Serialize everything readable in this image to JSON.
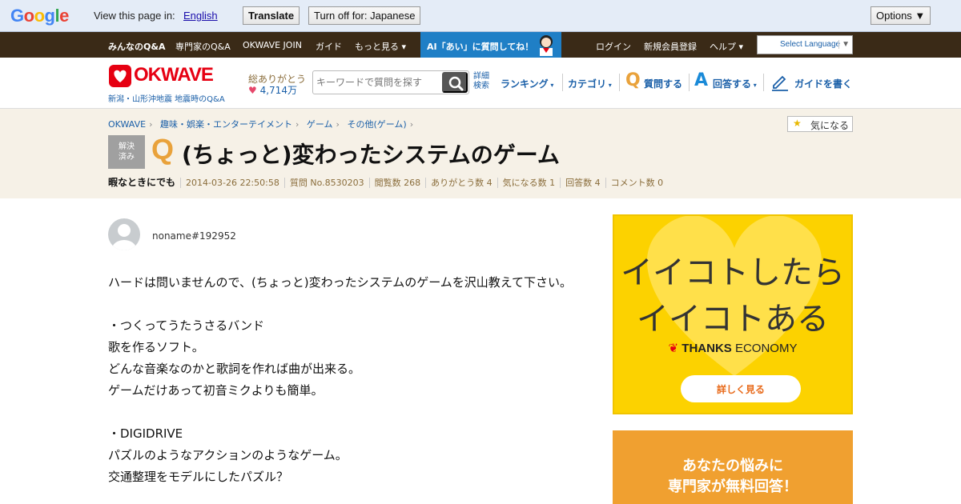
{
  "translate_bar": {
    "view_text": "View this page in:",
    "language": "English",
    "translate_label": "Translate",
    "turn_off_label": "Turn off for: Japanese",
    "options_label": "Options ▼"
  },
  "top_nav": {
    "items": [
      "みんなのQ&A",
      "専門家のQ&A",
      "OKWAVE JOIN",
      "ガイド",
      "もっと見る ▾"
    ],
    "ai_banner": "AI「あい」に質問してね！",
    "right_items": [
      "ログイン",
      "新規会員登録",
      "ヘルプ ▾"
    ],
    "language_select": "Select Language"
  },
  "header": {
    "logo_text": "OKWAVE",
    "logo_sub": "新潟・山形沖地震 地震時のQ&A",
    "thanks_label": "総ありがとう",
    "thanks_count": "4,714万",
    "search_placeholder": "キーワードで質問を探す",
    "advanced_search": "詳細検索",
    "ranking": "ランキング",
    "category": "カテゴリ",
    "ask": "質問する",
    "answer": "回答する",
    "guide": "ガイドを書く",
    "q_letter": "Q",
    "a_letter": "A"
  },
  "breadcrumbs": [
    "OKWAVE",
    "趣味・娯楽・エンターテイメント",
    "ゲーム",
    "その他(ゲーム)"
  ],
  "question": {
    "kininaru_label": "気になる",
    "solved_label_1": "解決",
    "solved_label_2": "済み",
    "q_mark": "Q",
    "title": "(ちょっと)変わったシステムのゲーム",
    "meta": {
      "subtitle": "暇なときにでも",
      "date": "2014-03-26 22:50:58",
      "number": "質問 No.8530203",
      "views": "閲覧数 268",
      "thanks": "ありがとう数 4",
      "kininaru": "気になる数 1",
      "answers": "回答数 4",
      "comments": "コメント数 0"
    },
    "username": "noname#192952",
    "body": [
      "ハードは問いませんので、(ちょっと)変わったシステムのゲームを沢山教えて下さい。",
      "",
      "・つくってうたうさるバンド",
      "歌を作るソフト。",
      "どんな音楽なのかと歌詞を作れば曲が出来る。",
      "ゲームだけあって初音ミクよりも簡単。",
      "",
      "・DIGIDRIVE",
      "パズルのようなアクションのようなゲーム。",
      "交通整理をモデルにしたパズル？"
    ]
  },
  "ads": {
    "ad1_line1": "イイコトしたら",
    "ad1_line2": "イイコトある",
    "ad1_brand_bold": "THANKS",
    "ad1_brand_rest": " ECONOMY",
    "ad1_button": "詳しく見る",
    "ad2_line1": "あなたの悩みに",
    "ad2_line2": "専門家が無料回答！"
  }
}
